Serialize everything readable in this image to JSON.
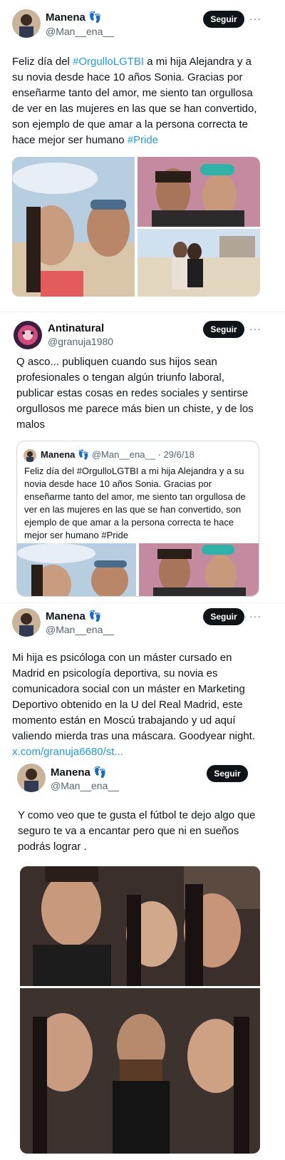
{
  "tweet1": {
    "name": "Manena",
    "emoji": "👣",
    "handle": "@Man__ena__",
    "follow_label": "Seguir",
    "text_before": "Feliz día del ",
    "hashtag1": "#OrgulloLGTBI",
    "text_middle": " a mi hija Alejandra y a su novia desde hace 10 años Sonia. Gracias por enseñarme  tanto del amor, me siento tan orgullosa de ver en las mujeres en las que se han convertido, son ejemplo de que amar a la persona correcta te hace mejor ser humano ",
    "hashtag2": "#Pride"
  },
  "tweet2": {
    "name": "Antinatural",
    "handle": "@granuja1980",
    "follow_label": "Seguir",
    "text": "Q asco... publiquen cuando sus hijos sean profesionales o tengan algún triunfo laboral, publicar estas cosas en redes sociales y sentirse orgullosos me parece más bien un chiste, y de los malos",
    "quote": {
      "name": "Manena",
      "emoji": "👣",
      "handle": "@Man__ena__",
      "date": "· 29/6/18",
      "text": "Feliz día del #OrgulloLGTBI a mi hija Alejandra y a su novia desde hace 10 años Sonia. Gracias por enseñarme  tanto del amor, me siento tan orgullosa de ver en las mujeres en las que se han convertido, son ejemplo de que amar a la persona correcta te hace mejor ser humano #Pride"
    }
  },
  "tweet3": {
    "name": "Manena",
    "emoji": "👣",
    "handle": "@Man__ena__",
    "follow_label": "Seguir",
    "text": "Mi hija es psicóloga con un máster cursado en Madrid en psicología deportiva, su novia es comunicadora social con un máster en Marketing Deportivo obtenido en la U del Real Madrid, este momento están en Moscú trabajando y ud aquí valiendo mierda tras una máscara. Goodyear night.",
    "link": "x.com/granuja6680/st..."
  },
  "tweet4": {
    "name": "Manena",
    "emoji": "👣",
    "handle": "@Man__ena__",
    "follow_label": "Seguir",
    "text": "Y como veo que te gusta el fútbol te dejo algo que seguro te va a encantar pero que ni en sueños podrás lograr ."
  },
  "more_glyph": "···",
  "colors": {
    "link": "#1d9bf0",
    "button": "#0f1419",
    "secondary": "#536471"
  }
}
